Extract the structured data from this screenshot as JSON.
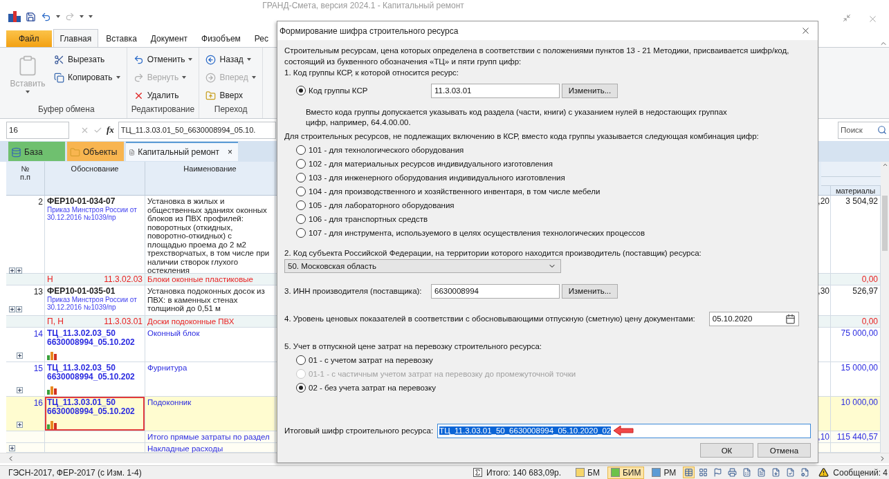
{
  "window": {
    "title": "ГРАНД-Смета, версия 2024.1 - Капитальный ремонт"
  },
  "ribbon": {
    "tabs": [
      {
        "label": "Файл",
        "kind": "file",
        "selected": false
      },
      {
        "label": "Главная",
        "kind": "tab",
        "selected": true
      },
      {
        "label": "Вставка",
        "kind": "tab",
        "selected": false
      },
      {
        "label": "Документ",
        "kind": "tab",
        "selected": false
      },
      {
        "label": "Физобъем",
        "kind": "tab",
        "selected": false
      },
      {
        "label": "Рес",
        "kind": "tab",
        "selected": false
      }
    ],
    "groups": [
      {
        "label": "Буфер обмена",
        "items": [
          {
            "label": "Вставить",
            "kind": "large",
            "disabled": true,
            "dropdown": true
          },
          {
            "label": "Вырезать",
            "kind": "small",
            "disabled": false,
            "dropdown": false
          },
          {
            "label": "Копировать",
            "kind": "small",
            "disabled": false,
            "dropdown": true
          }
        ]
      },
      {
        "label": "Редактирование",
        "items": [
          {
            "label": "Отменить",
            "kind": "small",
            "disabled": false,
            "dropdown": true
          },
          {
            "label": "Вернуть",
            "kind": "small",
            "disabled": true,
            "dropdown": true
          },
          {
            "label": "Удалить",
            "kind": "small",
            "disabled": false,
            "dropdown": false
          }
        ]
      },
      {
        "label": "Переход",
        "items": [
          {
            "label": "Назад",
            "kind": "small",
            "disabled": false,
            "dropdown": true
          },
          {
            "label": "Вперед",
            "kind": "small",
            "disabled": true,
            "dropdown": true
          },
          {
            "label": "Вверх",
            "kind": "small",
            "disabled": false,
            "dropdown": false
          }
        ]
      }
    ]
  },
  "formula_bar": {
    "cell": "16",
    "function_label": "fx",
    "formula": "ТЦ_11.3.03.01_50_6630008994_05.10.",
    "search_placeholder": "Поиск"
  },
  "doc_tabs": [
    {
      "label": "База",
      "kind": "base",
      "selected": false
    },
    {
      "label": "Объекты",
      "kind": "objects",
      "selected": false
    },
    {
      "label": "Капитальный ремонт",
      "kind": "document",
      "selected": true,
      "close_label": "×"
    }
  ],
  "table": {
    "columns": [
      {
        "label": "№ п.п"
      },
      {
        "label": "Обоснование"
      },
      {
        "label": "Наименование"
      },
      {
        "label": "материалы"
      }
    ],
    "rows": [
      {
        "kind": "position",
        "number": "2",
        "code": "ФЕР10-01-034-07",
        "reference": "Приказ Минстроя России от 30.12.2016 №1039/пр",
        "name": "Установка в жилых и общественных зданиях оконных блоков из ПВХ профилей: поворотных (откидных, поворотно-откидных) с площадью проема до 2 м2 трехстворчатых, в том числе при наличии створок глухого остекления",
        "column_4": ",20",
        "materials": "3 504,92",
        "selected": false
      },
      {
        "kind": "resource",
        "marks": "Н",
        "code": "11.3.02.03",
        "name": "Блоки оконные пластиковые",
        "materials": "0,00",
        "selected": false
      },
      {
        "kind": "position",
        "number": "13",
        "code": "ФЕР10-01-035-01",
        "reference": "Приказ Минстроя России от 30.12.2016 №1039/пр",
        "name": "Установка подоконных досок из ПВХ: в каменных стенах толщиной до 0,51 м",
        "column_4": ",30",
        "materials": "526,97",
        "selected": false
      },
      {
        "kind": "resource",
        "marks": "П, Н",
        "code": "11.3.03.01",
        "name": "Доски подоконные ПВХ",
        "materials": "0,00",
        "selected": false
      },
      {
        "kind": "price",
        "number": "14",
        "code_lines": [
          "ТЦ_11.3.02.03_50",
          "6630008994_05.10.202"
        ],
        "name": "Оконный блок",
        "materials": "75 000,00",
        "selected": false,
        "outlined": false
      },
      {
        "kind": "price",
        "number": "15",
        "code_lines": [
          "ТЦ_11.3.02.03_50",
          "6630008994_05.10.202"
        ],
        "name": "Фурнитура",
        "materials": "15 000,00",
        "selected": false,
        "outlined": false
      },
      {
        "kind": "price",
        "number": "16",
        "code_lines": [
          "ТЦ_11.3.03.01_50",
          "6630008994_05.10.202"
        ],
        "name": "Подоконник",
        "materials": "10 000,00",
        "selected": true,
        "outlined": true
      },
      {
        "kind": "total",
        "name": "Итого прямые затраты по раздел",
        "column_4": ",10",
        "materials": "115 440,57",
        "selected": false
      },
      {
        "kind": "overhead",
        "name": "Накладные расходы",
        "selected": false
      }
    ]
  },
  "status_bar": {
    "norms": "ГЭСН-2017, ФЕР-2017 (с Изм. 1-4)",
    "total": "Итого: 140 683,09р.",
    "modes": [
      {
        "label": "БМ",
        "color": "#f6d66b",
        "selected": false
      },
      {
        "label": "БИМ",
        "color": "#6cc24a",
        "selected": true
      },
      {
        "label": "РМ",
        "color": "#5b9bd5",
        "selected": false
      }
    ],
    "tools": [
      {
        "selected": true
      },
      {
        "selected": false
      },
      {
        "selected": false
      },
      {
        "selected": false
      },
      {
        "selected": false
      },
      {
        "selected": false
      },
      {
        "selected": false
      },
      {
        "selected": false
      },
      {
        "selected": false
      }
    ],
    "messages": "Сообщений: 4"
  },
  "dialog": {
    "title": "Формирование шифра строительного ресурса",
    "intro": "Строительным ресурсам, цена которых определена в соответствии с положениями пунктов 13 - 21 Методики, присваивается шифр/код, состоящий из буквенного обозначения «ТЦ» и пяти групп цифр:",
    "group_section": {
      "label": "1. Код группы КСР, к которой относится ресурс:",
      "option": {
        "label": "Код группы КСР",
        "selected": true
      },
      "value": "11.3.03.01",
      "button": "Изменить...",
      "note": "Вместо кода группы допускается указывать код раздела (части, книги) с указанием нулей в недостающих группах цифр, например, 64.4.00.00."
    },
    "alt_label": "Для строительных ресурсов, не подлежащих включению в КСР, вместо кода группы указывается следующая комбинация цифр:",
    "alt_options": [
      {
        "label": "101 - для технологического оборудования",
        "selected": false
      },
      {
        "label": "102 - для материальных ресурсов индивидуального изготовления",
        "selected": false
      },
      {
        "label": "103 - для инженерного оборудования индивидуального изготовления",
        "selected": false
      },
      {
        "label": "104 - для производственного и хозяйственного инвентаря, в том числе мебели",
        "selected": false
      },
      {
        "label": "105 - для лабораторного оборудования",
        "selected": false
      },
      {
        "label": "106 - для транспортных средств",
        "selected": false
      },
      {
        "label": "107 - для инструмента, используемого в целях осуществления технологических процессов",
        "selected": false
      }
    ],
    "region_section": {
      "label": "2. Код субъекта Российской Федерации, на территории которого находится производитель (поставщик)  ресурса:",
      "value": "50. Московская область"
    },
    "inn_section": {
      "label": "3. ИНН производителя (поставщика):",
      "value": "6630008994",
      "button": "Изменить..."
    },
    "date_section": {
      "label": "4. Уровень ценовых показателей в соответствии с обосновывающими отпускную (сметную) цену документами:",
      "value": "05.10.2020"
    },
    "transport_section": {
      "label": "5. Учет в отпускной цене затрат на перевозку строительного ресурса:",
      "options": [
        {
          "label": "01 - с учетом затрат на перевозку",
          "selected": false,
          "disabled": false
        },
        {
          "label": "01-1 - с частичным учетом затрат на перевозку до промежуточной точки",
          "selected": false,
          "disabled": true
        },
        {
          "label": "02 - без учета затрат на перевозку",
          "selected": true,
          "disabled": false
        }
      ]
    },
    "result": {
      "label": "Итоговый шифр строительного ресурса:",
      "value": "ТЦ_11.3.03.01_50_6630008994_05.10.2020_02",
      "text_selected": true
    },
    "buttons": [
      "ОК",
      "Отмена"
    ]
  }
}
